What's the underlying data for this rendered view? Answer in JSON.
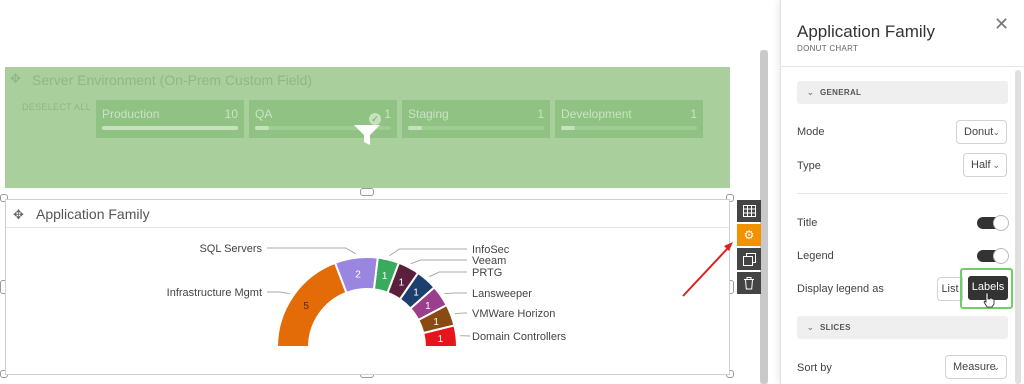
{
  "filter_widget": {
    "title": "Server Environment (On-Prem Custom Field)",
    "deselect_label": "DESELECT ALL",
    "chips": [
      {
        "label": "Production",
        "count": "10",
        "fill": 1.0
      },
      {
        "label": "QA",
        "count": "1",
        "fill": 0.1
      },
      {
        "label": "Staging",
        "count": "1",
        "fill": 0.1
      },
      {
        "label": "Development",
        "count": "1",
        "fill": 0.1
      }
    ]
  },
  "chart_widget": {
    "title": "Application Family"
  },
  "chart_data": {
    "type": "pie",
    "variant": "half-donut",
    "legend_display": "labels",
    "slices": [
      {
        "label": "Infrastructure Mgmt",
        "value": 5,
        "color": "#e36c09"
      },
      {
        "label": "SQL Servers",
        "value": 2,
        "color": "#9a86e0"
      },
      {
        "label": "InfoSec",
        "value": 1,
        "color": "#3aaa5c"
      },
      {
        "label": "Veeam",
        "value": 1,
        "color": "#5a1f3c"
      },
      {
        "label": "PRTG",
        "value": 1,
        "color": "#1d3f6e"
      },
      {
        "label": "Lansweeper",
        "value": 1,
        "color": "#9b3f8c"
      },
      {
        "label": "VMWare Horizon",
        "value": 1,
        "color": "#8a4a13"
      },
      {
        "label": "Domain Controllers",
        "value": 1,
        "color": "#e8131b"
      }
    ]
  },
  "side_tools": [
    "table-icon",
    "gear-icon",
    "duplicate-icon",
    "trash-icon"
  ],
  "panel": {
    "title": "Application Family",
    "subtitle": "DONUT CHART",
    "close": "✕",
    "general_label": "GENERAL",
    "mode_label": "Mode",
    "mode_value": "Donut",
    "type_label": "Type",
    "type_value": "Half",
    "title_label": "Title",
    "legend_label": "Legend",
    "display_legend_label": "Display legend as",
    "list_option": "List",
    "labels_option": "Labels",
    "slices_label": "SLICES",
    "sort_label": "Sort by",
    "sort_value": "Measure"
  },
  "colors": {
    "accent_orange": "#f39200",
    "filter_green": "#a9cf9d",
    "highlight_green": "#6fcf64",
    "arrow_red": "#e02020"
  }
}
